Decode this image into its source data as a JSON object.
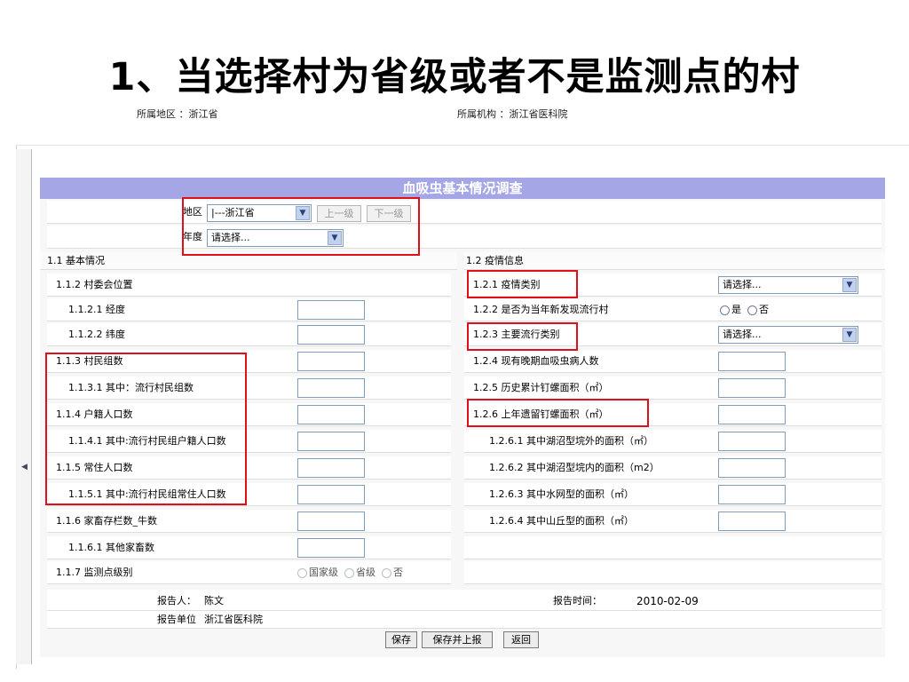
{
  "slide": {
    "title": "1、当选择村为省级或者不是监测点的村",
    "region_meta": "所属地区 ：浙江省",
    "org_meta": "所属机构 ：浙江省医科院"
  },
  "form": {
    "header": "血吸虫基本情况调查",
    "region_label": "地区",
    "region_value": "|---浙江省",
    "prev_level": "上一级",
    "next_level": "下一级",
    "year_label": "年度",
    "year_value": "请选择..."
  },
  "left": {
    "section_title": "1.1 基本情况",
    "rows": [
      {
        "label": "1.1.2 村委会位置"
      },
      {
        "label": "1.1.2.1 经度"
      },
      {
        "label": "1.1.2.2 纬度"
      },
      {
        "label": "1.1.3 村民组数"
      },
      {
        "label": "1.1.3.1 其中：流行村民组数"
      },
      {
        "label": "1.1.4 户籍人口数"
      },
      {
        "label": "1.1.4.1 其中:流行村民组户籍人口数"
      },
      {
        "label": "1.1.5 常住人口数"
      },
      {
        "label": "1.1.5.1 其中:流行村民组常住人口数"
      },
      {
        "label": "1.1.6 家畜存栏数_牛数"
      },
      {
        "label": "1.1.6.1 其他家畜数"
      },
      {
        "label": "1.1.7 监测点级别"
      }
    ],
    "monitor_options": [
      "国家级",
      "省级",
      "否"
    ]
  },
  "right": {
    "section_title": "1.2 疫情信息",
    "rows": [
      {
        "label": "1.2.1 疫情类别"
      },
      {
        "label": "1.2.2 是否为当年新发现流行村"
      },
      {
        "label": "1.2.3 主要流行类别"
      },
      {
        "label": "1.2.4 现有晚期血吸虫病人数"
      },
      {
        "label": "1.2.5 历史累计钉螺面积（㎡）"
      },
      {
        "label": "1.2.6 上年遗留钉螺面积（㎡）"
      },
      {
        "label": "1.2.6.1 其中湖沼型垸外的面积（㎡）"
      },
      {
        "label": "1.2.6.2 其中湖沼型垸内的面积（m2）"
      },
      {
        "label": "1.2.6.3 其中水网型的面积（㎡）"
      },
      {
        "label": "1.2.6.4 其中山丘型的面积（㎡）"
      }
    ],
    "select_placeholder": "请选择...",
    "yes_label": "是",
    "no_label": "否"
  },
  "footer": {
    "reporter_label": "报告人：",
    "reporter_value": "陈文",
    "unit_label": "报告单位",
    "unit_value": "浙江省医科院",
    "time_label": "报告时间：",
    "time_value": "2010-02-09"
  },
  "actions": {
    "save": "保存",
    "save_report": "保存并上报",
    "back": "返回"
  },
  "colors": {
    "header_bg": "#a5a6e6",
    "highlight": "#e0101b"
  }
}
